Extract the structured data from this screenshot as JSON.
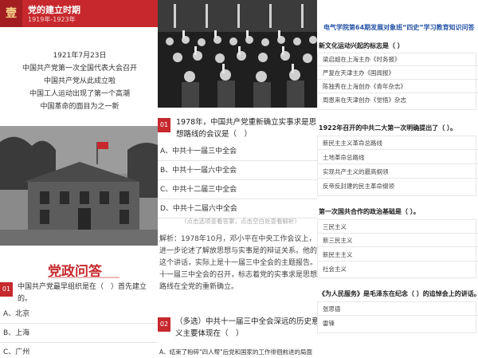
{
  "left": {
    "badge": "壹",
    "title": "党的建立时期",
    "years": "1919年-1923年",
    "intro_lines": [
      "1921年7月23日",
      "中国共产党第一次全国代表大会召开",
      "中国共产党从此成立啦",
      "中国工人运动出现了第一个高潮",
      "中国革命的面目为之一新"
    ],
    "section_title": "党政问答",
    "question_num": "01",
    "question": "中国共产党最早组织是在（　）首先建立的。",
    "options": [
      "A、北京",
      "B、上海",
      "C、广州"
    ]
  },
  "middle": {
    "question_num": "01",
    "question": "1978年，中国共产党重新确立实事求是思想路线的会议是（　）",
    "options": [
      "A、中共十一届三中全会",
      "B、中共十一届六中全会",
      "C、中共十二届三中全会",
      "D、中共十二届六中全会"
    ],
    "hint": "（点击选项查看答案，点击空白处查看解析）",
    "explanation": "解析：1978年10月，邓小平在中央工作会议上，进一步论述了解放思想与实事是的辩证关系。他的这个讲话，实际上是十一届三中全会的主题报告。十一届三中全会的召开，标志着党的实事求是思想路线在全党的重新确立。",
    "question2_num": "02",
    "question2": "（多选）中共十一届三中全会深远的历史意义主要体现在（　）",
    "option2_a": "A、结束了粉碎\"四人帮\"后党和国家的工作徘徊前进的局面"
  },
  "right": {
    "header": "电气学院第64期发展对象班“四史”学习教育知识问答",
    "q1": "新文化运动兴起的标志是（ ）",
    "q1_options": [
      "梁启超在上海主办《时务报》",
      "严复在天津主办《国闻报》",
      "陈独秀在上海创办《青年杂志》",
      "周恩来在天津创办《觉悟》杂志"
    ],
    "q2": "1922年召开的中共二大第一次明确提出了（ ）。",
    "q2_options": [
      "新民主主义革命总路线",
      "土地革命总路线",
      "实现共产主义的最高纲领",
      "反帝反封建的民主革命纲领"
    ],
    "q3": "第一次国共合作的政治基础是（ ）。",
    "q3_options": [
      "三民主义",
      "新三民主义",
      "新民主主义",
      "社会主义"
    ],
    "q4": "《为人民服务》是毛泽东在纪念（ ）的追悼会上的讲话。",
    "q4_options": [
      "张思德",
      "雷锋"
    ]
  },
  "colors": {
    "brand_red": "#c6282d",
    "link_blue": "#2855a8"
  }
}
